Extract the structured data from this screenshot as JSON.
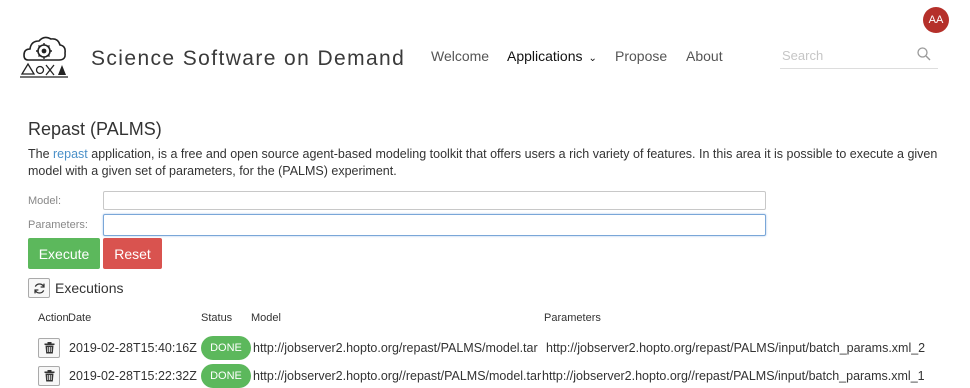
{
  "user": {
    "initials": "AA"
  },
  "header": {
    "brand": "Science Software on Demand",
    "nav": [
      {
        "label": "Welcome"
      },
      {
        "label": "Applications"
      },
      {
        "label": "Propose"
      },
      {
        "label": "About"
      }
    ],
    "search": {
      "placeholder": "Search"
    }
  },
  "page": {
    "title": "Repast (PALMS)",
    "description_prefix": "The ",
    "description_link": "repast",
    "description_rest": " application, is a free and open source agent-based modeling toolkit that offers users a rich variety of features. In this area it is possible to execute a given model with a given set of parameters, for the (PALMS) experiment."
  },
  "form": {
    "model_label": "Model:",
    "model_value": "",
    "parameters_label": "Parameters:",
    "parameters_value": "",
    "execute_label": "Execute",
    "reset_label": "Reset"
  },
  "executions": {
    "title": "Executions",
    "columns": {
      "action": "Action",
      "date": "Date",
      "status": "Status",
      "model": "Model",
      "parameters": "Parameters"
    },
    "rows": [
      {
        "date": "2019-02-28T15:40:16Z",
        "status": "DONE",
        "model": "http://jobserver2.hopto.org/repast/PALMS/model.tar",
        "parameters": "http://jobserver2.hopto.org/repast/PALMS/input/batch_params.xml_2"
      },
      {
        "date": "2019-02-28T15:22:32Z",
        "status": "DONE",
        "model": "http://jobserver2.hopto.org//repast/PALMS/model.tar",
        "parameters": "http://jobserver2.hopto.org//repast/PALMS/input/batch_params.xml_1"
      }
    ]
  },
  "colors": {
    "success": "#5cb85c",
    "danger": "#d9534f",
    "avatar": "#b5302a",
    "link": "#4a90c8"
  }
}
